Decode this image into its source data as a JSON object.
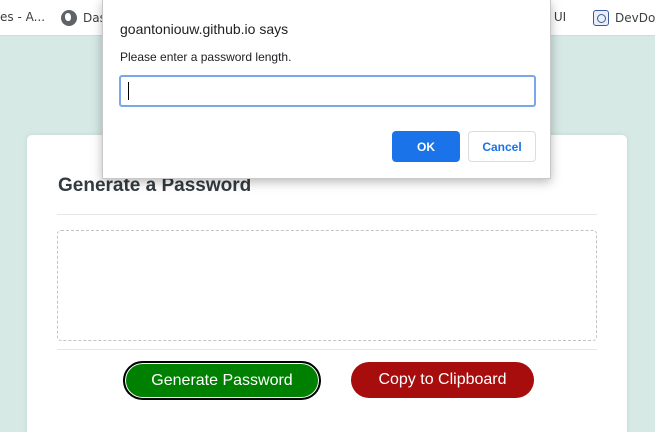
{
  "bookmarks": {
    "items": [
      {
        "label": "es - A...",
        "icon": "none"
      },
      {
        "label": "Das",
        "icon": "globe-icon"
      },
      {
        "label": "ry UI",
        "icon": "none"
      },
      {
        "label": "DevDoc",
        "icon": "devdocs-icon"
      }
    ]
  },
  "app": {
    "title": "Generate a Password",
    "password_placeholder": "",
    "generate_label": "Generate Password",
    "copy_label": "Copy to Clipboard",
    "colors": {
      "page_bg": "#d6e9e5",
      "generate_btn": "#008000",
      "copy_btn": "#a70d0d"
    }
  },
  "dialog": {
    "origin": "goantoniouw.github.io says",
    "message": "Please enter a password length.",
    "input_value": "",
    "ok_label": "OK",
    "cancel_label": "Cancel",
    "accent": "#1a73e8"
  }
}
